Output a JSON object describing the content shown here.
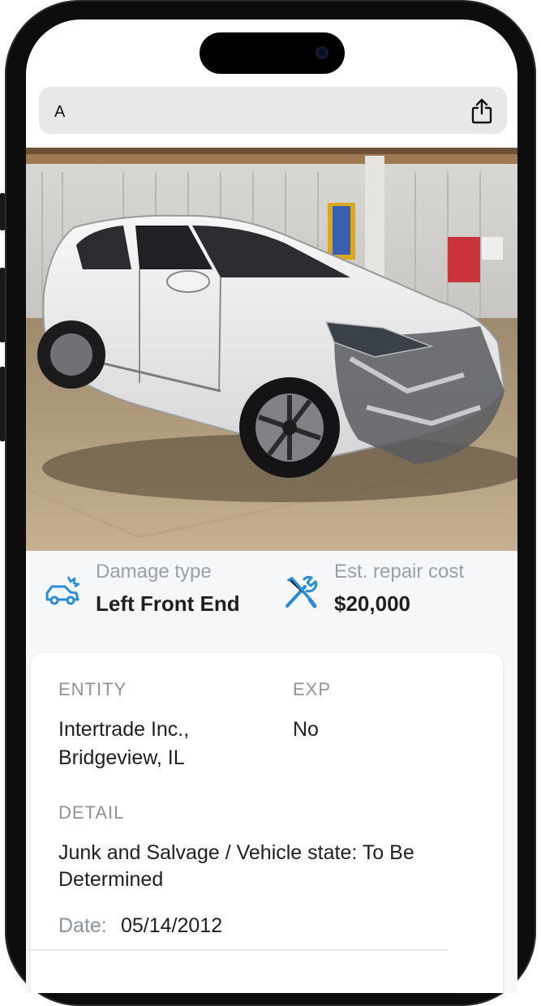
{
  "browser": {
    "url_text": "A",
    "share_icon": "share-icon"
  },
  "vehicle_photo": {
    "icon": "vehicle-photo"
  },
  "info": {
    "damage": {
      "icon": "car-damage-icon",
      "label": "Damage type",
      "value": "Left Front End"
    },
    "repair": {
      "icon": "wrench-screwdriver-icon",
      "label": "Est. repair cost",
      "value": "$20,000"
    }
  },
  "record": {
    "entity_label": "ENTITY",
    "entity_line1": "Intertrade Inc.,",
    "entity_line2": "Bridgeview, IL",
    "exp_label": "EXP",
    "exp_value": "No",
    "detail_label": "DETAIL",
    "detail_line1": "Junk and Salvage / Vehicle state: To Be",
    "detail_line2": "Determined",
    "date_label": "Date:",
    "date_value": "05/14/2012"
  },
  "colors": {
    "accent_blue": "#2a8bd6",
    "label_gray": "#9aa0a6",
    "text_dark": "#1d1f21"
  }
}
